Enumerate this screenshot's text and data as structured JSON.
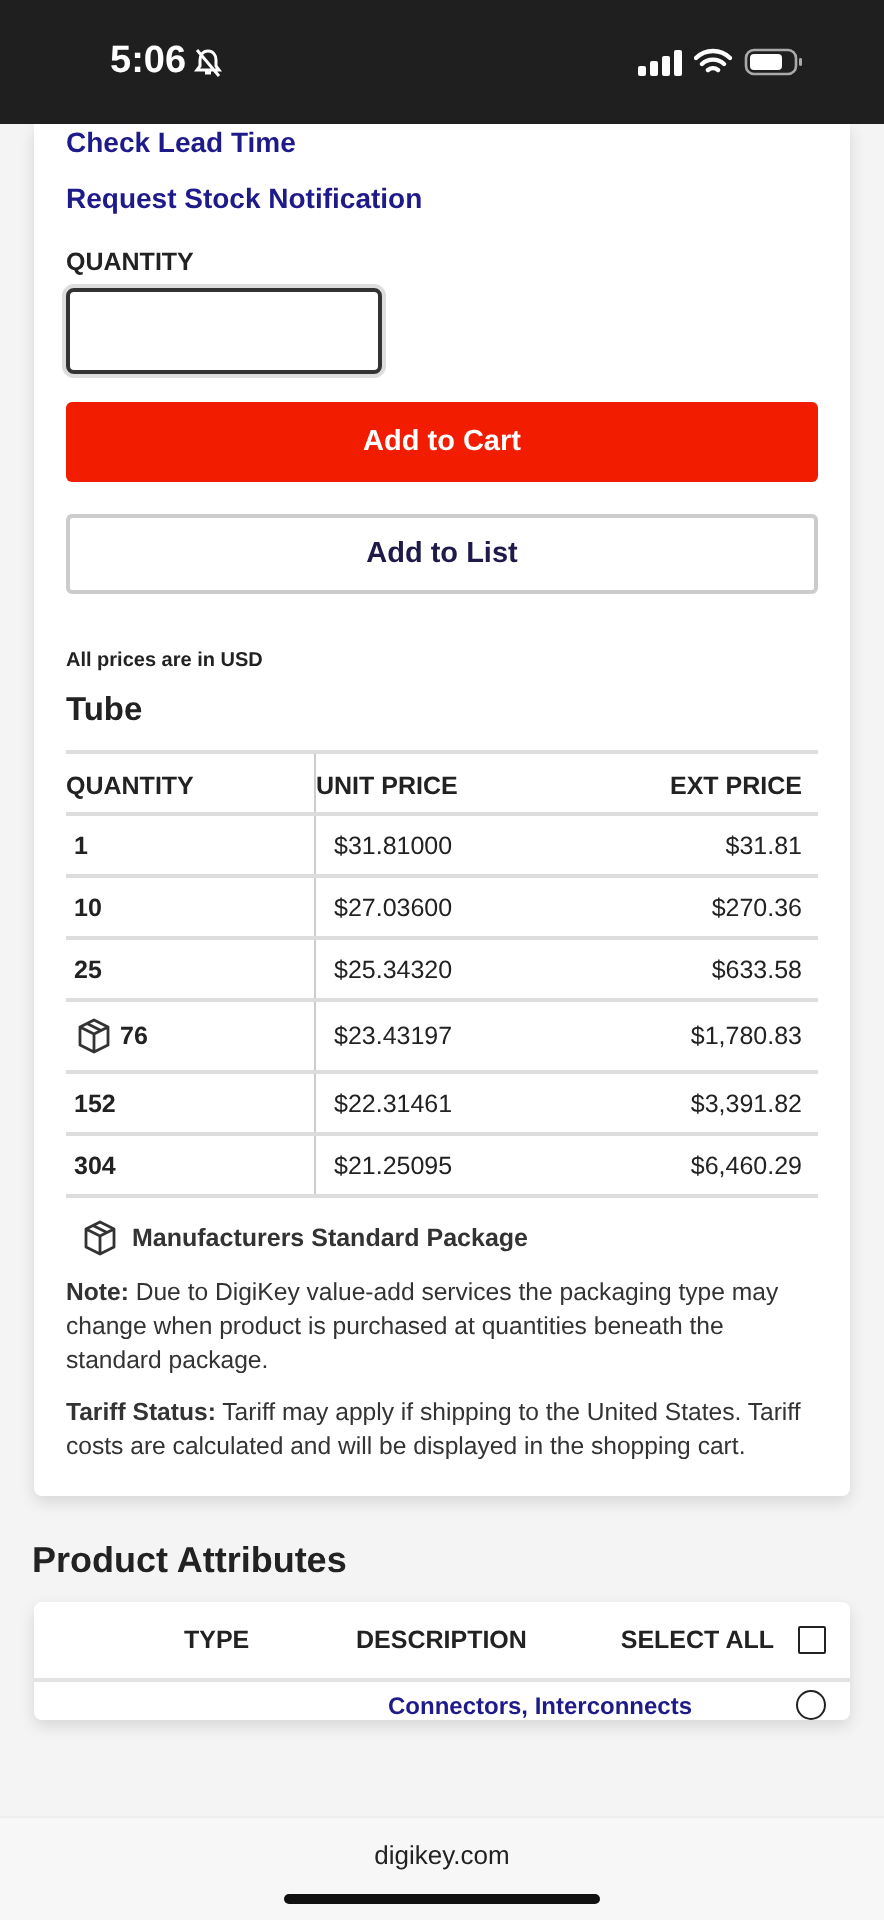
{
  "status_bar": {
    "time": "5:06"
  },
  "links": [
    "Check Lead Time",
    "Request Stock Notification"
  ],
  "quantity_field": {
    "label": "QUANTITY"
  },
  "buttons": [
    {
      "label": "Add to Cart",
      "kind": "primary"
    },
    {
      "label": "Add to List",
      "kind": "secondary"
    }
  ],
  "currency_note": "All prices are in USD",
  "pricing": {
    "title": "Tube",
    "columns": [
      "QUANTITY",
      "UNIT PRICE",
      "EXT PRICE"
    ],
    "rows": [
      {
        "quantity": "1",
        "unit_price": "$31.81000",
        "ext_price": "$31.81",
        "standard_package": false
      },
      {
        "quantity": "10",
        "unit_price": "$27.03600",
        "ext_price": "$270.36",
        "standard_package": false
      },
      {
        "quantity": "25",
        "unit_price": "$25.34320",
        "ext_price": "$633.58",
        "standard_package": false
      },
      {
        "quantity": "76",
        "unit_price": "$23.43197",
        "ext_price": "$1,780.83",
        "standard_package": true
      },
      {
        "quantity": "152",
        "unit_price": "$22.31461",
        "ext_price": "$3,391.82",
        "standard_package": false
      },
      {
        "quantity": "304",
        "unit_price": "$21.25095",
        "ext_price": "$6,460.29",
        "standard_package": false
      }
    ],
    "legend": "Manufacturers Standard Package",
    "notes": [
      "**Note:** Due to DigiKey value-add services the packaging type may change when product is purchased at quantities beneath the standard package.",
      "**Tariff Status:** Tariff may apply if shipping to the United States. Tariff costs are calculated and will be displayed in the shopping cart."
    ]
  },
  "attributes": {
    "title": "Product Attributes",
    "columns": [
      "TYPE",
      "DESCRIPTION",
      "SELECT ALL"
    ],
    "select_all_checked": false,
    "rows": [
      {
        "description": "Connectors, Interconnects",
        "selected": false
      }
    ]
  },
  "browser_bar": {
    "url": "digikey.com"
  }
}
